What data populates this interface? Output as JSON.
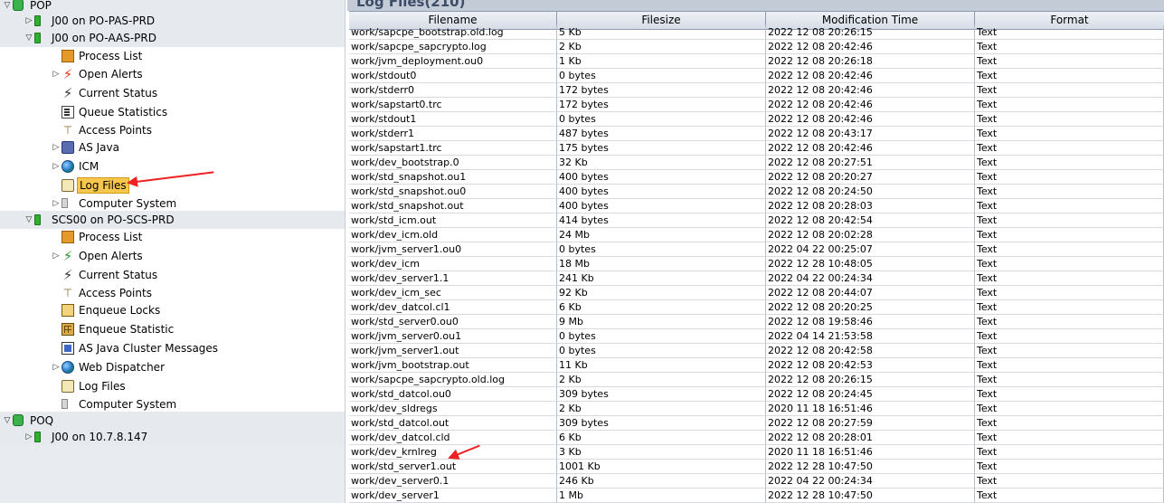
{
  "tree": {
    "items": [
      {
        "label": "POP",
        "level": 0,
        "twisty": "expanded",
        "icon": "database-icon",
        "band": true
      },
      {
        "label": "J00 on PO-PAS-PRD",
        "level": 1,
        "twisty": "collapsed",
        "icon": "server-instance-icon",
        "band": true
      },
      {
        "label": "J00 on PO-AAS-PRD",
        "level": 1,
        "twisty": "expanded",
        "icon": "server-instance-icon",
        "band": true
      },
      {
        "label": "Process List",
        "level": 2,
        "twisty": "",
        "icon": "process-list-icon"
      },
      {
        "label": "Open Alerts",
        "level": 2,
        "twisty": "collapsed",
        "icon": "alert-bolt-red-icon"
      },
      {
        "label": "Current Status",
        "level": 2,
        "twisty": "",
        "icon": "status-bolt-icon"
      },
      {
        "label": "Queue Statistics",
        "level": 2,
        "twisty": "",
        "icon": "queue-statistics-icon"
      },
      {
        "label": "Access Points",
        "level": 2,
        "twisty": "",
        "icon": "access-points-icon"
      },
      {
        "label": "AS Java",
        "level": 2,
        "twisty": "collapsed",
        "icon": "java-icon"
      },
      {
        "label": "ICM",
        "level": 2,
        "twisty": "collapsed",
        "icon": "globe-icon"
      },
      {
        "label": "Log Files",
        "level": 2,
        "twisty": "",
        "icon": "log-files-icon",
        "selected": true
      },
      {
        "label": "Computer System",
        "level": 2,
        "twisty": "collapsed",
        "icon": "computer-system-icon"
      },
      {
        "label": "SCS00 on PO-SCS-PRD",
        "level": 1,
        "twisty": "expanded",
        "icon": "server-instance-icon",
        "band": true
      },
      {
        "label": "Process List",
        "level": 2,
        "twisty": "",
        "icon": "process-list-icon"
      },
      {
        "label": "Open Alerts",
        "level": 2,
        "twisty": "collapsed",
        "icon": "alert-bolt-green-icon"
      },
      {
        "label": "Current Status",
        "level": 2,
        "twisty": "",
        "icon": "status-bolt-icon"
      },
      {
        "label": "Access Points",
        "level": 2,
        "twisty": "",
        "icon": "access-points-icon"
      },
      {
        "label": "Enqueue Locks",
        "level": 2,
        "twisty": "",
        "icon": "lock-icon"
      },
      {
        "label": "Enqueue Statistic",
        "level": 2,
        "twisty": "",
        "icon": "grid-icon"
      },
      {
        "label": "AS Java Cluster Messages",
        "level": 2,
        "twisty": "",
        "icon": "cluster-messages-icon"
      },
      {
        "label": "Web Dispatcher",
        "level": 2,
        "twisty": "collapsed",
        "icon": "globe-icon"
      },
      {
        "label": "Log Files",
        "level": 2,
        "twisty": "",
        "icon": "log-files-icon"
      },
      {
        "label": "Computer System",
        "level": 2,
        "twisty": "",
        "icon": "computer-system-icon"
      },
      {
        "label": "POQ",
        "level": 0,
        "twisty": "expanded",
        "icon": "database-icon",
        "band": true
      },
      {
        "label": "J00 on 10.7.8.147",
        "level": 1,
        "twisty": "collapsed",
        "icon": "server-instance-icon",
        "band": true
      }
    ]
  },
  "panel": {
    "title": "Log Files(210)",
    "columns": [
      "Filename",
      "Filesize",
      "Modification Time",
      "Format"
    ],
    "rows": [
      [
        "work/sapcpe_bootstrap.old.log",
        "5 Kb",
        "2022 12 08 20:26:15",
        "Text"
      ],
      [
        "work/sapcpe_sapcrypto.log",
        "2 Kb",
        "2022 12 08 20:42:46",
        "Text"
      ],
      [
        "work/jvm_deployment.ou0",
        "1 Kb",
        "2022 12 08 20:26:18",
        "Text"
      ],
      [
        "work/stdout0",
        "0 bytes",
        "2022 12 08 20:42:46",
        "Text"
      ],
      [
        "work/stderr0",
        "172 bytes",
        "2022 12 08 20:42:46",
        "Text"
      ],
      [
        "work/sapstart0.trc",
        "172 bytes",
        "2022 12 08 20:42:46",
        "Text"
      ],
      [
        "work/stdout1",
        "0 bytes",
        "2022 12 08 20:42:46",
        "Text"
      ],
      [
        "work/stderr1",
        "487 bytes",
        "2022 12 08 20:43:17",
        "Text"
      ],
      [
        "work/sapstart1.trc",
        "175 bytes",
        "2022 12 08 20:42:46",
        "Text"
      ],
      [
        "work/dev_bootstrap.0",
        "32 Kb",
        "2022 12 08 20:27:51",
        "Text"
      ],
      [
        "work/std_snapshot.ou1",
        "400 bytes",
        "2022 12 08 20:20:27",
        "Text"
      ],
      [
        "work/std_snapshot.ou0",
        "400 bytes",
        "2022 12 08 20:24:50",
        "Text"
      ],
      [
        "work/std_snapshot.out",
        "400 bytes",
        "2022 12 08 20:28:03",
        "Text"
      ],
      [
        "work/std_icm.out",
        "414 bytes",
        "2022 12 08 20:42:54",
        "Text"
      ],
      [
        "work/dev_icm.old",
        "24 Mb",
        "2022 12 08 20:02:28",
        "Text"
      ],
      [
        "work/jvm_server1.ou0",
        "0 bytes",
        "2022 04 22 00:25:07",
        "Text"
      ],
      [
        "work/dev_icm",
        "18 Mb",
        "2022 12 28 10:48:05",
        "Text"
      ],
      [
        "work/dev_server1.1",
        "241 Kb",
        "2022 04 22 00:24:34",
        "Text"
      ],
      [
        "work/dev_icm_sec",
        "92 Kb",
        "2022 12 08 20:44:07",
        "Text"
      ],
      [
        "work/dev_datcol.cl1",
        "6 Kb",
        "2022 12 08 20:20:25",
        "Text"
      ],
      [
        "work/std_server0.ou0",
        "9 Mb",
        "2022 12 08 19:58:46",
        "Text"
      ],
      [
        "work/jvm_server0.ou1",
        "0 bytes",
        "2022 04 14 21:53:58",
        "Text"
      ],
      [
        "work/jvm_server1.out",
        "0 bytes",
        "2022 12 08 20:42:58",
        "Text"
      ],
      [
        "work/jvm_bootstrap.out",
        "11 Kb",
        "2022 12 08 20:42:53",
        "Text"
      ],
      [
        "work/sapcpe_sapcrypto.old.log",
        "2 Kb",
        "2022 12 08 20:26:15",
        "Text"
      ],
      [
        "work/std_datcol.ou0",
        "309 bytes",
        "2022 12 08 20:24:45",
        "Text"
      ],
      [
        "work/dev_sldregs",
        "2 Kb",
        "2020 11 18 16:51:46",
        "Text"
      ],
      [
        "work/std_datcol.out",
        "309 bytes",
        "2022 12 08 20:27:59",
        "Text"
      ],
      [
        "work/dev_datcol.cld",
        "6 Kb",
        "2022 12 08 20:28:01",
        "Text"
      ],
      [
        "work/dev_krnlreg",
        "3 Kb",
        "2020 11 18 16:51:46",
        "Text"
      ],
      [
        "work/std_server1.out",
        "1001 Kb",
        "2022 12 28 10:47:50",
        "Text"
      ],
      [
        "work/dev_server0.1",
        "246 Kb",
        "2022 04 22 00:24:34",
        "Text"
      ],
      [
        "work/dev_server1",
        "1 Mb",
        "2022 12 28 10:47:50",
        "Text"
      ]
    ]
  },
  "colors": {
    "selected_bg": "#f7c64c",
    "arrow": "#e22222",
    "band": "#e6e9ee",
    "header_bg": "#dde3ec"
  }
}
